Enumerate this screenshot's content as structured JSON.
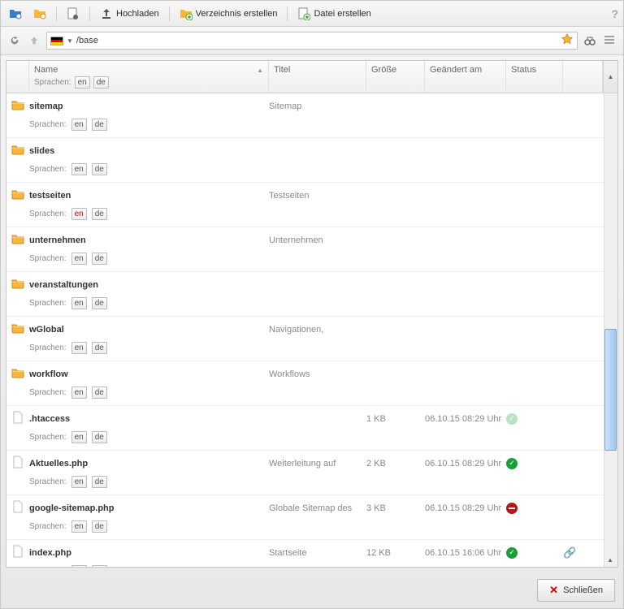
{
  "toolbar": {
    "upload": "Hochladen",
    "create_dir": "Verzeichnis erstellen",
    "create_file": "Datei erstellen"
  },
  "navbar": {
    "path": "/base"
  },
  "columns": {
    "name": "Name",
    "title": "Titel",
    "size": "Größe",
    "modified": "Geändert am",
    "status": "Status",
    "sprachen": "Sprachen:",
    "lang_en": "en",
    "lang_de": "de"
  },
  "rows": [
    {
      "icon": "folder",
      "name": "sitemap",
      "title": "Sitemap",
      "size": "",
      "date": "",
      "status": "",
      "en": "en",
      "de": "de"
    },
    {
      "icon": "folder",
      "name": "slides",
      "title": "",
      "size": "",
      "date": "",
      "status": "",
      "en": "en",
      "de": "de"
    },
    {
      "icon": "folder",
      "name": "testseiten",
      "title": "Testseiten",
      "size": "",
      "date": "",
      "status": "",
      "en": "en",
      "de": "de",
      "en_red": true
    },
    {
      "icon": "folder",
      "name": "unternehmen",
      "title": "Unternehmen",
      "size": "",
      "date": "",
      "status": "",
      "en": "en",
      "de": "de"
    },
    {
      "icon": "folder",
      "name": "veranstaltungen",
      "title": "",
      "size": "",
      "date": "",
      "status": "",
      "en": "en",
      "de": "de"
    },
    {
      "icon": "folder",
      "name": "wGlobal",
      "title": "Navigationen,",
      "size": "",
      "date": "",
      "status": "",
      "en": "en",
      "de": "de"
    },
    {
      "icon": "folder",
      "name": "workflow",
      "title": "Workflows",
      "size": "",
      "date": "",
      "status": "",
      "en": "en",
      "de": "de"
    },
    {
      "icon": "file",
      "name": ".htaccess",
      "title": "",
      "size": "1 KB",
      "date": "06.10.15 08:29 Uhr",
      "status": "ok-light",
      "en": "en",
      "de": "de"
    },
    {
      "icon": "file",
      "name": "Aktuelles.php",
      "title": "Weiterleitung auf",
      "size": "2 KB",
      "date": "06.10.15 08:29 Uhr",
      "status": "ok",
      "en": "en",
      "de": "de"
    },
    {
      "icon": "file",
      "name": "google-sitemap.php",
      "title": "Globale Sitemap des",
      "size": "3 KB",
      "date": "06.10.15 08:29 Uhr",
      "status": "block",
      "en": "en",
      "de": "de"
    },
    {
      "icon": "file",
      "name": "index.php",
      "title": "Startseite",
      "size": "12 KB",
      "date": "06.10.15 16:06 Uhr",
      "status": "ok",
      "en": "en",
      "de": "de",
      "link": true
    }
  ],
  "footer": {
    "close": "Schließen"
  }
}
